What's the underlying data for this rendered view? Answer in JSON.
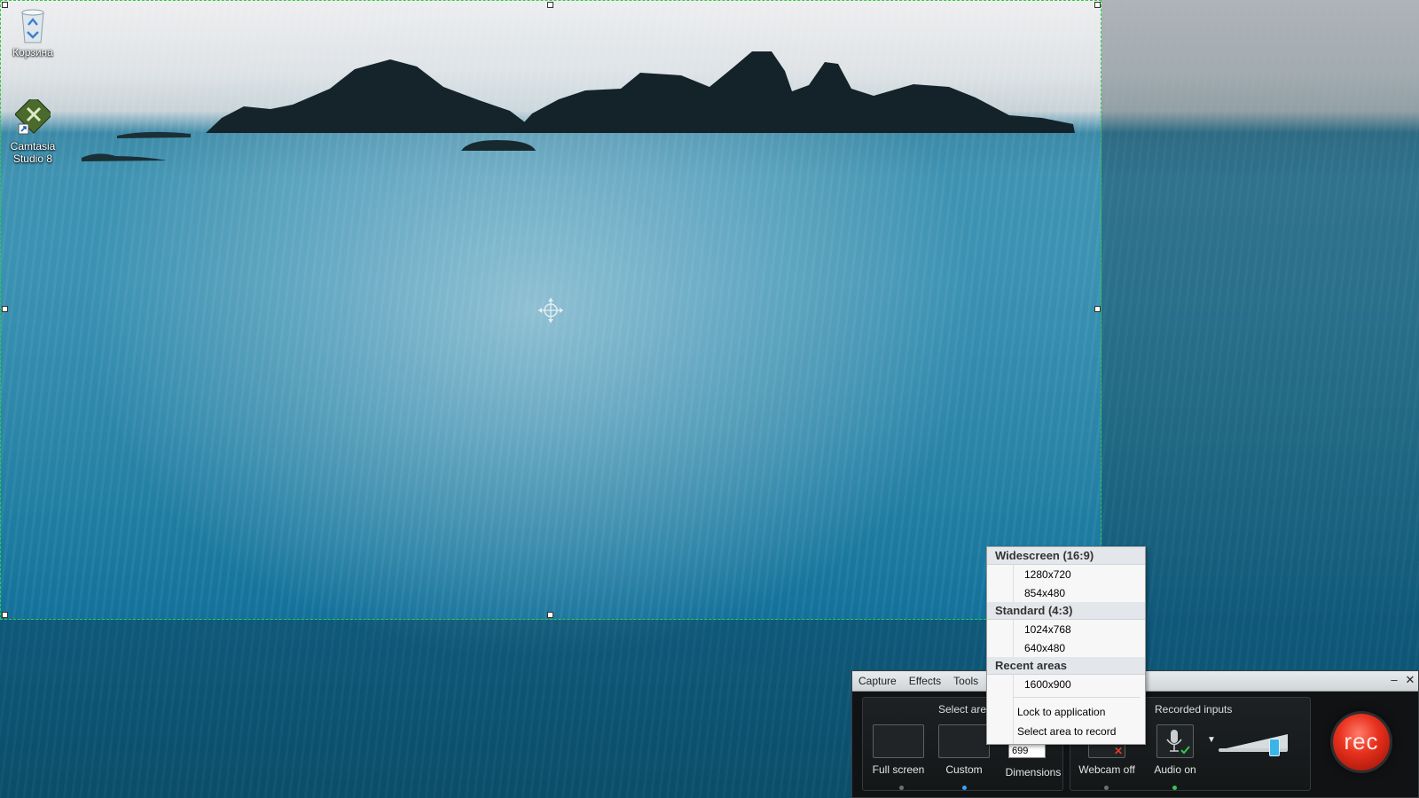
{
  "desktop": {
    "icons": [
      {
        "label": "Корзина",
        "icon": "recycle-bin-icon"
      },
      {
        "label": "Camtasia Studio 8",
        "icon": "camtasia-icon"
      }
    ]
  },
  "recorder": {
    "menu": [
      "Capture",
      "Effects",
      "Tools"
    ],
    "select_area_title": "Select area",
    "recorded_inputs_title": "Recorded inputs",
    "full_screen_label": "Full screen",
    "custom_label": "Custom",
    "dimensions_label": "Dimensions",
    "dimension_height_value": "699",
    "webcam_label": "Webcam off",
    "audio_label": "Audio on",
    "rec_label": "rec",
    "minimize_symbol": "–",
    "close_symbol": "✕"
  },
  "dropdown": {
    "sections": [
      {
        "header": "Widescreen (16:9)",
        "items": [
          "1280x720",
          "854x480"
        ]
      },
      {
        "header": "Standard (4:3)",
        "items": [
          "1024x768",
          "640x480"
        ]
      },
      {
        "header": "Recent areas",
        "items": [
          "1600x900"
        ]
      }
    ],
    "actions": [
      "Lock to application",
      "Select area to record"
    ]
  },
  "colors": {
    "selection_border": "#2ecc40",
    "rec_button": "#e8321e",
    "toolbar_bg": "#101213"
  }
}
